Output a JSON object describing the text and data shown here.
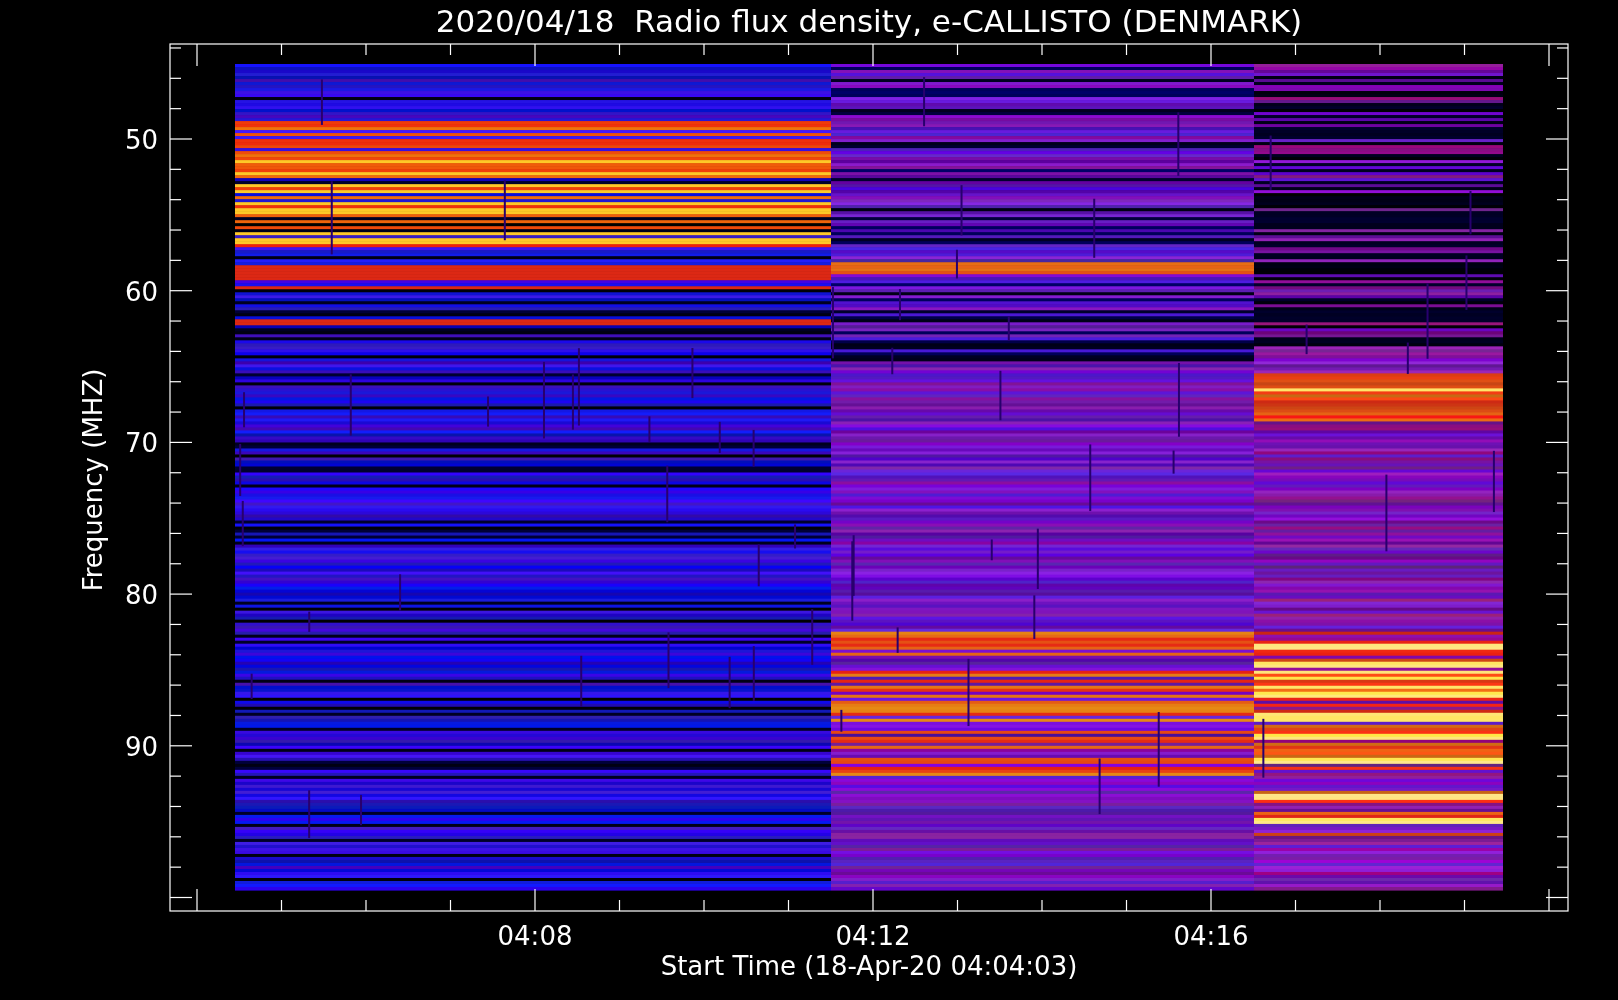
{
  "title": "2020/04/18  Radio flux density, e-CALLISTO (DENMARK)",
  "y_axis": {
    "label": "Frequency (MHZ)",
    "ticks": [
      "50",
      "60",
      "70",
      "80",
      "90"
    ]
  },
  "x_axis": {
    "label": "Start Time (18-Apr-20 04:04:03)",
    "ticks": [
      "04:08",
      "04:12",
      "04:16"
    ]
  }
}
